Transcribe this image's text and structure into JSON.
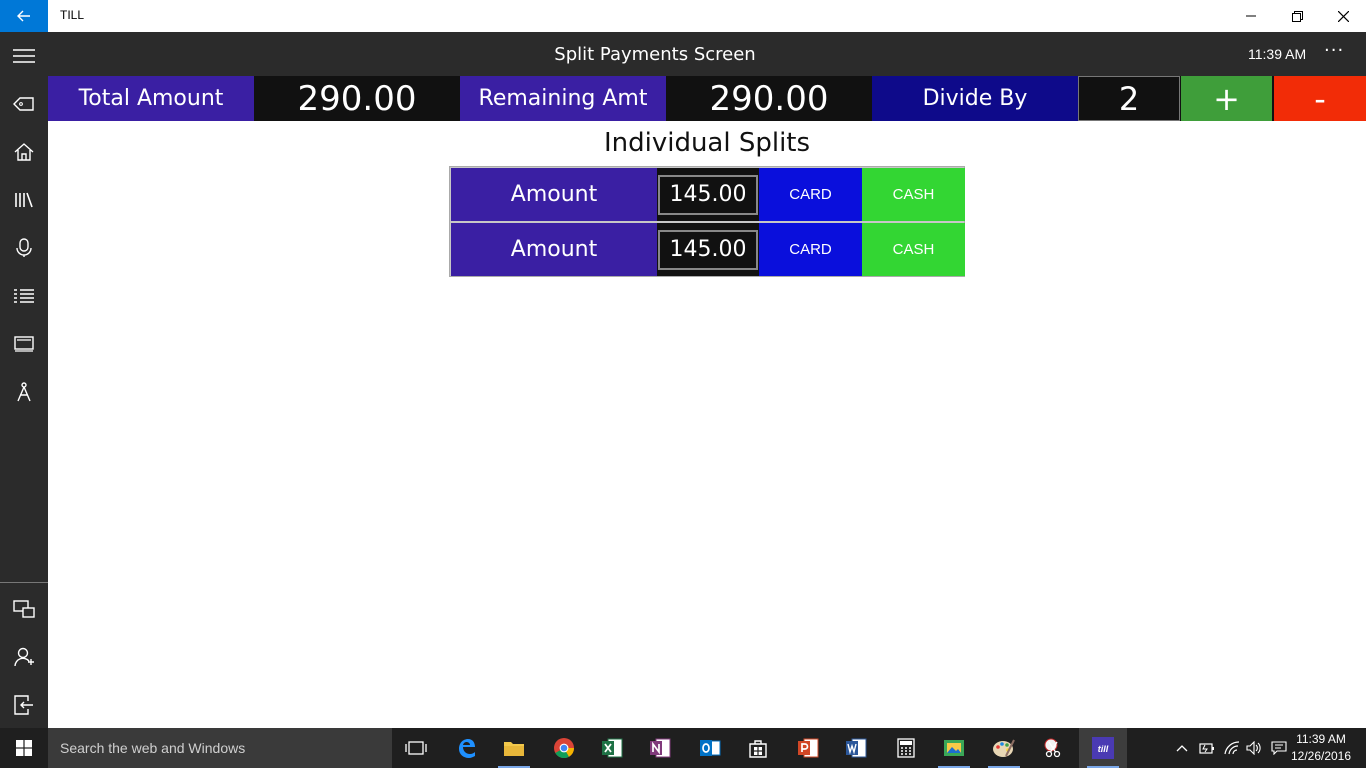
{
  "titlebar": {
    "title": "TILL"
  },
  "header": {
    "screen_title": "Split Payments Screen",
    "time": "11:39 AM",
    "more": "···"
  },
  "totals": {
    "total_label": "Total Amount",
    "total_value": "290.00",
    "remaining_label": "Remaining Amt",
    "remaining_value": "290.00",
    "divide_label": "Divide By",
    "divide_value": "2",
    "plus_label": "+",
    "minus_label": "-"
  },
  "splits": {
    "title": "Individual Splits",
    "rows": [
      {
        "label": "Amount",
        "amount": "145.00",
        "card": "CARD",
        "cash": "CASH"
      },
      {
        "label": "Amount",
        "amount": "145.00",
        "card": "CARD",
        "cash": "CASH"
      }
    ]
  },
  "taskbar": {
    "search_placeholder": "Search the web and Windows",
    "clock_time": "11:39 AM",
    "clock_date": "12/26/2016",
    "till_label": "till"
  },
  "colors": {
    "label_purple": "#3a1fa3",
    "divide_navy": "#0e0a8a",
    "card_blue": "#0a0fdc",
    "cash_green": "#33d633",
    "plus_green": "#3f9e3a",
    "minus_red": "#f22c07",
    "accent": "#0078d7"
  }
}
